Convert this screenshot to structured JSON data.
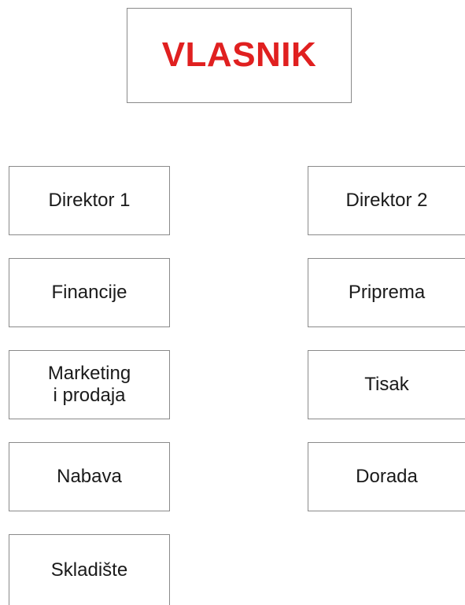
{
  "owner": {
    "label": "VLASNIK",
    "color": "#e02020"
  },
  "left_column": {
    "director": "Direktor 1",
    "units": [
      "Financije",
      "Marketing",
      "i prodaja",
      "Nabava",
      "Skladište"
    ]
  },
  "right_column": {
    "director": "Direktor 2",
    "units": [
      "Priprema",
      "Tisak",
      "Dorada"
    ]
  }
}
